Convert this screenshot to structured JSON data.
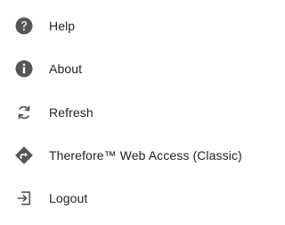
{
  "menu": {
    "items": [
      {
        "label": "Help",
        "icon": "help-icon"
      },
      {
        "label": "About",
        "icon": "info-icon"
      },
      {
        "label": "Refresh",
        "icon": "refresh-icon"
      },
      {
        "label": "Therefore™ Web Access (Classic)",
        "icon": "web-access-icon"
      },
      {
        "label": "Logout",
        "icon": "logout-icon"
      }
    ],
    "icon_color": "#555555",
    "text_color": "#222222"
  }
}
